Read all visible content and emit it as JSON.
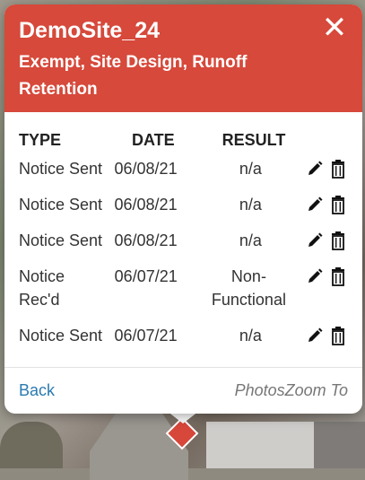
{
  "popup": {
    "title": "DemoSite_24",
    "subtitle": "Exempt, Site Design, Runoff Retention",
    "close_label": "✕"
  },
  "table": {
    "headers": {
      "type": "TYPE",
      "date": "DATE",
      "result": "RESULT"
    },
    "rows": [
      {
        "type": "Notice Sent",
        "date": "06/08/21",
        "result": "n/a"
      },
      {
        "type": "Notice Sent",
        "date": "06/08/21",
        "result": "n/a"
      },
      {
        "type": "Notice Sent",
        "date": "06/08/21",
        "result": "n/a"
      },
      {
        "type": "Notice Rec'd",
        "date": "06/07/21",
        "result": "Non-Functional"
      },
      {
        "type": "Notice Sent",
        "date": "06/07/21",
        "result": "n/a"
      }
    ]
  },
  "footer": {
    "back_label": "Back",
    "links_label": "PhotosZoom To"
  },
  "icons": {
    "edit": "pencil-icon",
    "delete": "trash-icon",
    "marker": "map-marker-icon"
  },
  "colors": {
    "header": "#d6493b",
    "link": "#2a7ab0"
  }
}
